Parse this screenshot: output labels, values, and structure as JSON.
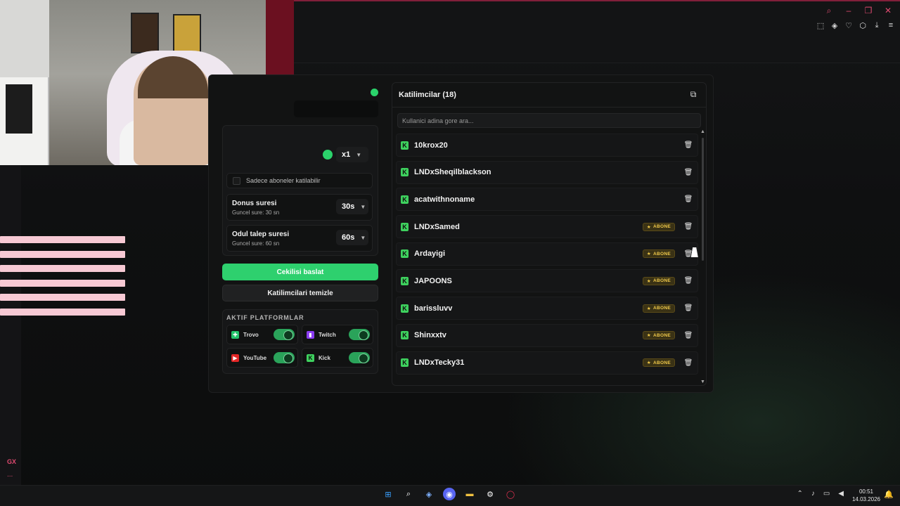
{
  "browser": {
    "window_controls": [
      "search-icon",
      "minimize-icon",
      "restore-icon",
      "close-icon"
    ],
    "toolbar_icons": [
      "screenshot-icon",
      "shield-icon",
      "heart-icon",
      "extensions-icon",
      "download-icon",
      "menu-icon"
    ],
    "gx_label": "GX",
    "more_label": "..."
  },
  "left_panel": {
    "subscribers_only_label": "Sadece aboneler katilabilir",
    "multiplier_value": "x1",
    "spin_duration": {
      "title": "Donus suresi",
      "subtitle": "Guncel sure: 30 sn",
      "value": "30s"
    },
    "claim_duration": {
      "title": "Odul talep suresi",
      "subtitle": "Guncel sure: 60 sn",
      "value": "60s"
    },
    "start_button": "Cekilisi baslat",
    "clear_button": "Katilimcilari temizle",
    "platforms_title": "AKTIF PLATFORMLAR",
    "platforms": [
      {
        "name": "Trovo",
        "color": "#23c36b",
        "enabled": true
      },
      {
        "name": "Twitch",
        "color": "#8a3cf0",
        "enabled": true
      },
      {
        "name": "YouTube",
        "color": "#e32626",
        "enabled": true
      },
      {
        "name": "Kick",
        "color": "#3ed15e",
        "enabled": true
      }
    ],
    "accent_color": "#2ed06e"
  },
  "participants": {
    "title": "Katilimcilar (18)",
    "search_placeholder": "Kullanici adina gore ara...",
    "badge_label": "ABONE",
    "rows": [
      {
        "name": "10krox20",
        "subscriber": false
      },
      {
        "name": "LNDxSheqilblackson",
        "subscriber": false
      },
      {
        "name": "acatwithnoname",
        "subscriber": false
      },
      {
        "name": "LNDxSamed",
        "subscriber": true
      },
      {
        "name": "Ardayigi",
        "subscriber": true
      },
      {
        "name": "JAPOONS",
        "subscriber": true
      },
      {
        "name": "barissluvv",
        "subscriber": true
      },
      {
        "name": "Shinxxtv",
        "subscriber": true
      },
      {
        "name": "LNDxTecky31",
        "subscriber": true
      }
    ]
  },
  "taskbar": {
    "time": "00:51",
    "date": "14.03.2026",
    "icons": [
      "windows-start-icon",
      "search-icon",
      "app-icon",
      "discord-icon",
      "file-explorer-icon",
      "steam-icon",
      "opera-gx-icon"
    ]
  }
}
